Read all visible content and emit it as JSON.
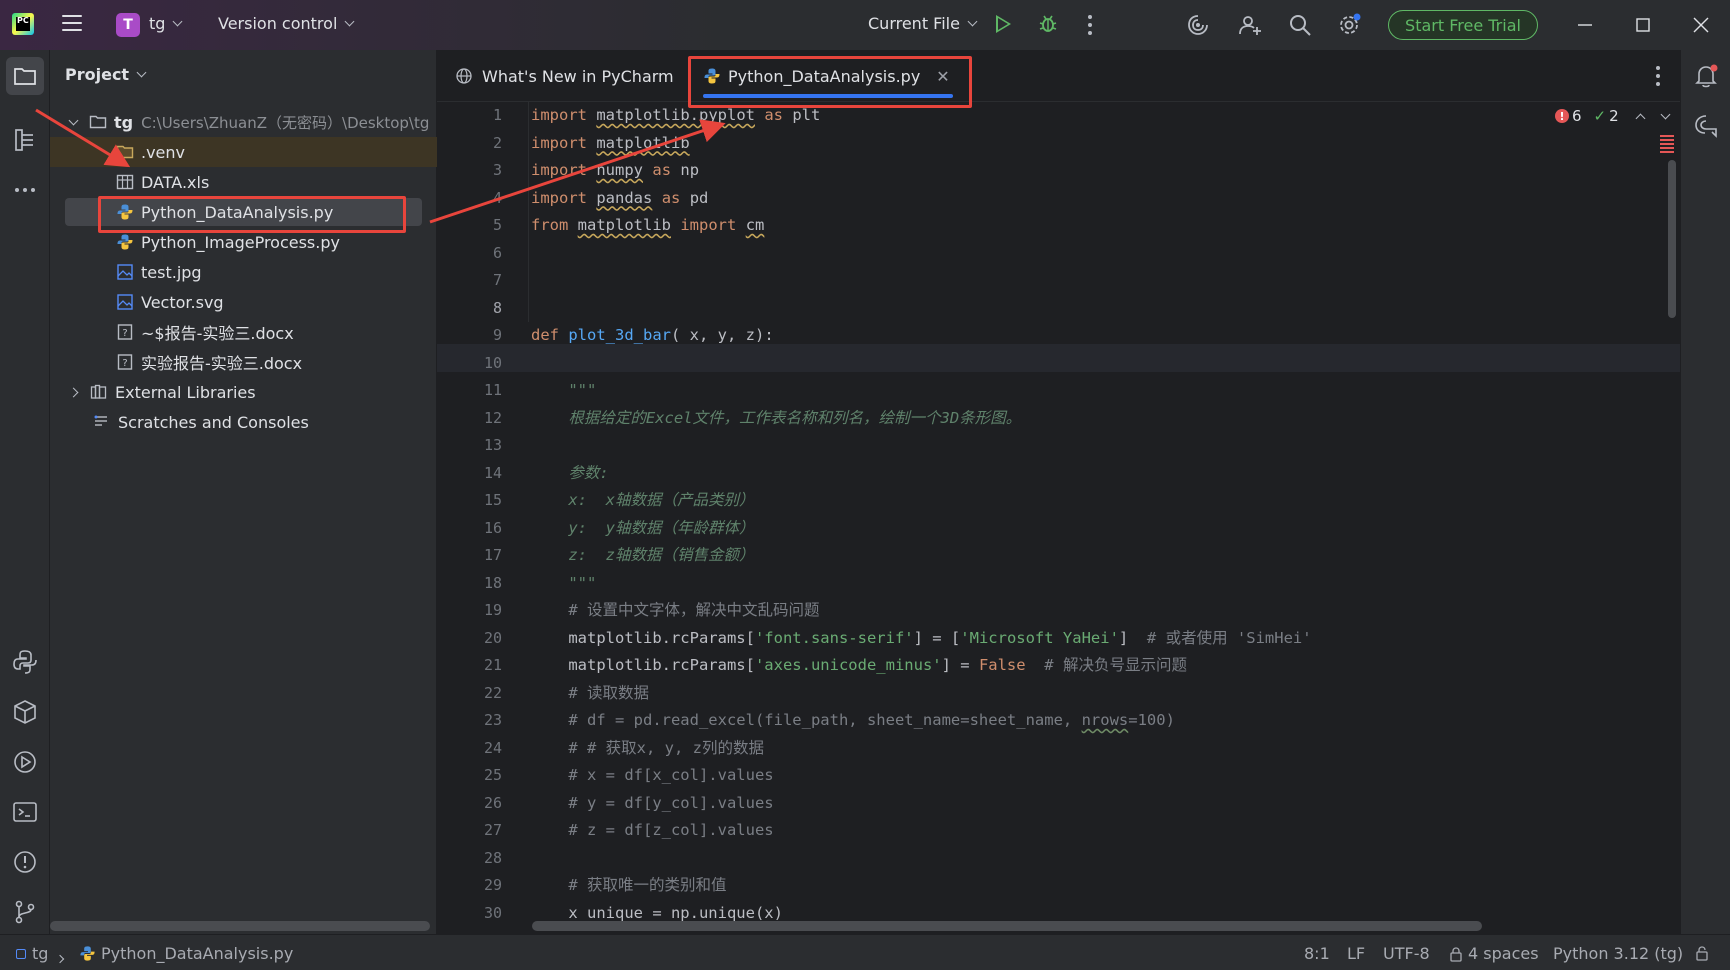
{
  "titlebar": {
    "project_badge": "T",
    "project_name": "tg",
    "version_control": "Version control",
    "run_config": "Current File",
    "trial_button": "Start Free Trial"
  },
  "project_panel": {
    "title": "Project",
    "root": {
      "name": "tg",
      "path": "C:\\Users\\ZhuanZ（无密码）\\Desktop\\tg"
    },
    "items": [
      {
        "label": ".venv",
        "type": "folder"
      },
      {
        "label": "DATA.xls",
        "type": "table"
      },
      {
        "label": "Python_DataAnalysis.py",
        "type": "python"
      },
      {
        "label": "Python_ImageProcess.py",
        "type": "python"
      },
      {
        "label": "test.jpg",
        "type": "image"
      },
      {
        "label": "Vector.svg",
        "type": "image"
      },
      {
        "label": "~$报告-实验三.docx",
        "type": "unknown"
      },
      {
        "label": "实验报告-实验三.docx",
        "type": "unknown"
      }
    ],
    "external_libraries": "External Libraries",
    "scratches": "Scratches and Consoles"
  },
  "editor": {
    "tabs": [
      {
        "label": "What's New in PyCharm",
        "active": false
      },
      {
        "label": "Python_DataAnalysis.py",
        "active": true
      }
    ],
    "inspections": {
      "errors": "6",
      "warnings": "2"
    },
    "line_numbers": [
      "1",
      "2",
      "3",
      "4",
      "5",
      "6",
      "7",
      "8",
      "9",
      "10",
      "11",
      "12",
      "13",
      "14",
      "15",
      "16",
      "17",
      "18",
      "19",
      "20",
      "21",
      "22",
      "23",
      "24",
      "25",
      "26",
      "27",
      "28",
      "29",
      "30"
    ],
    "current_line": 8,
    "code_tokens": {
      "l1_import": "import",
      "l1_mod": "matplotlib.pyplot",
      "l1_as": "as",
      "l1_alias": "plt",
      "l2_import": "import",
      "l2_mod": "matplotlib",
      "l3_import": "import",
      "l3_mod": "numpy",
      "l3_as": "as",
      "l3_alias": "np",
      "l4_import": "import",
      "l4_mod": "pandas",
      "l4_as": "as",
      "l4_alias": "pd",
      "l5_from": "from",
      "l5_mod": "matplotlib",
      "l5_import": "import",
      "l5_name": "cm",
      "l9_def": "def",
      "l9_fn": "plot_3d_bar",
      "l9_args": "( x, y, z):",
      "l11": "    \"\"\"",
      "l12": "    根据给定的Excel文件，工作表名称和列名，绘制一个3D条形图。",
      "l14": "    参数:",
      "l15": "    x:  x轴数据（产品类别）",
      "l16": "    y:  y轴数据（年龄群体）",
      "l17": "    z:  z轴数据（销售金额）",
      "l18": "    \"\"\"",
      "l19": "    # 设置中文字体，解决中文乱码问题",
      "l20_a": "    matplotlib.rcParams[",
      "l20_key": "'font.sans-serif'",
      "l20_b": "] = [",
      "l20_val": "'Microsoft YaHei'",
      "l20_c": "]  ",
      "l20_cmt": "# 或者使用 'SimHei'",
      "l21_a": "    matplotlib.rcParams[",
      "l21_key": "'axes.unicode_minus'",
      "l21_b": "] = ",
      "l21_val": "False",
      "l21_c": "  ",
      "l21_cmt": "# 解决负号显示问题",
      "l22": "    # 读取数据",
      "l23_a": "    # df = pd.read_excel(file_path, sheet_name=sheet_name, ",
      "l23_u": "nrows",
      "l23_b": "=100)",
      "l24": "    # # 获取x, y, z列的数据",
      "l25": "    # x = df[x_col].values",
      "l26": "    # y = df[y_col].values",
      "l27": "    # z = df[z_col].values",
      "l29": "    # 获取唯一的类别和值",
      "l30": "    x_unique = np.unique(x)"
    }
  },
  "statusbar": {
    "project": "tg",
    "file": "Python_DataAnalysis.py",
    "position": "8:1",
    "line_sep": "LF",
    "encoding": "UTF-8",
    "indent": "4 spaces",
    "interpreter": "Python 3.12 (tg)"
  },
  "colors": {
    "accent": "#3574f0",
    "run": "#5fb865",
    "annotation": "#e8453c",
    "error": "#e55757"
  }
}
